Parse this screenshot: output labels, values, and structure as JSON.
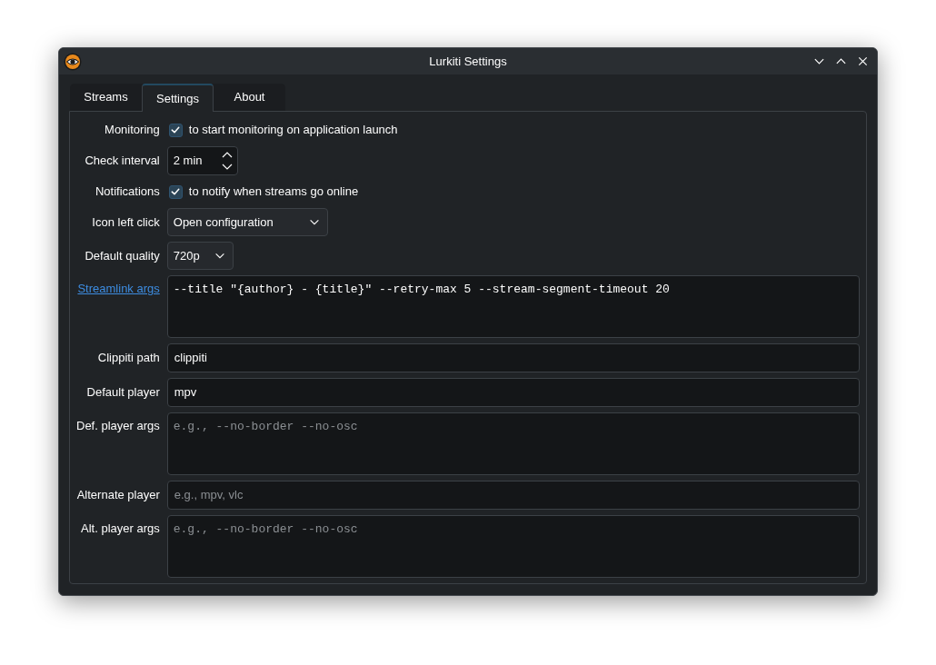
{
  "window": {
    "title": "Lurkiti Settings"
  },
  "tabs": [
    {
      "label": "Streams",
      "selected": false
    },
    {
      "label": "Settings",
      "selected": true
    },
    {
      "label": "About",
      "selected": false
    }
  ],
  "form": {
    "rows": [
      {
        "kind": "checkbox",
        "label": "Monitoring",
        "link": false,
        "checked": true,
        "text": "to start monitoring on application launch"
      },
      {
        "kind": "spinbox",
        "label": "Check interval",
        "link": false,
        "value": "2 min"
      },
      {
        "kind": "checkbox",
        "label": "Notifications",
        "link": false,
        "checked": true,
        "text": "to notify when streams go online"
      },
      {
        "kind": "combo",
        "label": "Icon left click",
        "link": false,
        "value": "Open configuration"
      },
      {
        "kind": "combo",
        "label": "Default quality",
        "link": false,
        "value": "720p"
      },
      {
        "kind": "textarea",
        "label": "Streamlink args",
        "link": true,
        "value": "--title \"{author} - {title}\" --retry-max 5 --stream-segment-timeout 20"
      },
      {
        "kind": "input",
        "label": "Clippiti path",
        "link": false,
        "value": "clippiti"
      },
      {
        "kind": "input",
        "label": "Default player",
        "link": false,
        "value": "mpv"
      },
      {
        "kind": "textarea",
        "label": "Def. player args",
        "link": false,
        "placeholder": "e.g., --no-border --no-osc"
      },
      {
        "kind": "input",
        "label": "Alternate player",
        "link": false,
        "placeholder": "e.g., mpv, vlc"
      },
      {
        "kind": "textarea",
        "label": "Alt. player args",
        "link": false,
        "placeholder": "e.g., --no-border --no-osc"
      }
    ]
  }
}
